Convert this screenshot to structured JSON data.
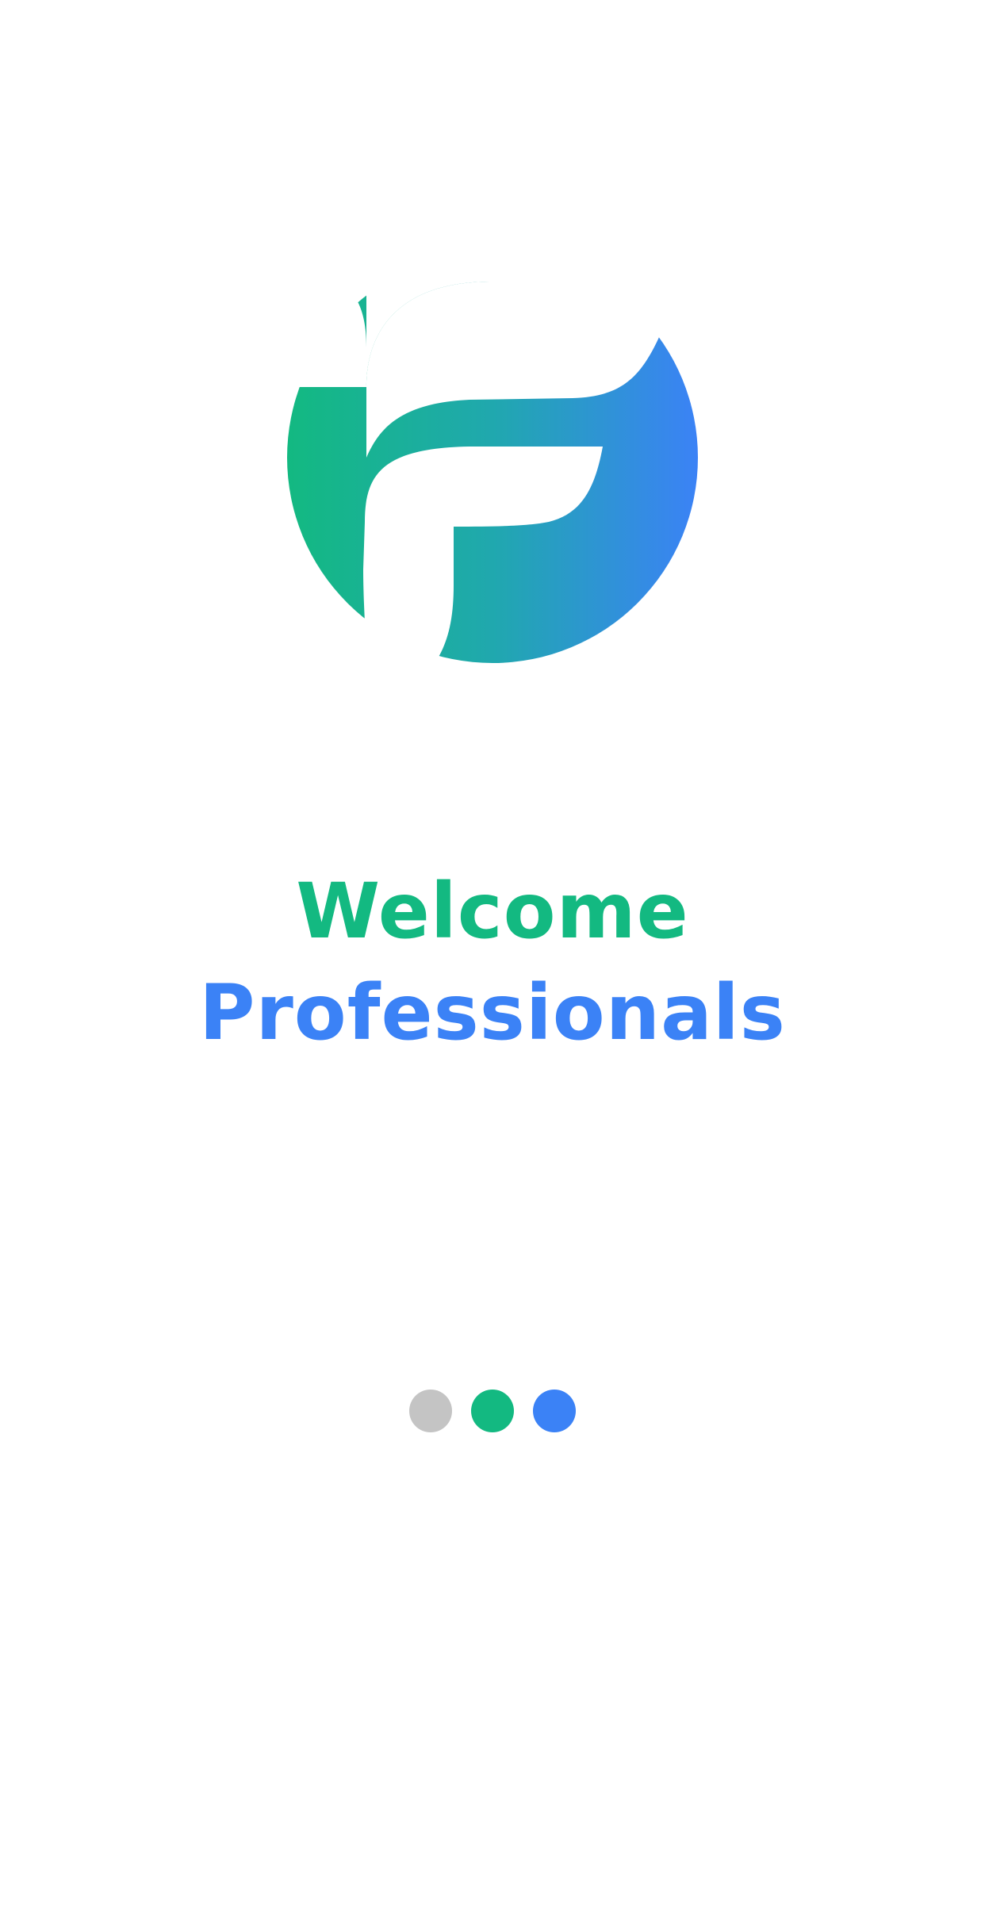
{
  "app": {
    "logo_icon": "f-logo-icon"
  },
  "colors": {
    "brand_green": "#13B981",
    "brand_teal": "#20A8AE",
    "brand_blue": "#3B82F6",
    "dot_inactive": "#C4C4C4",
    "background": "#FFFFFF"
  },
  "welcome": {
    "line1": "Welcome",
    "line2": "Professionals"
  },
  "pager": {
    "dots": [
      {
        "state": "inactive",
        "color": "#C4C4C4"
      },
      {
        "state": "active-green",
        "color": "#13B981"
      },
      {
        "state": "active-blue",
        "color": "#3B82F6"
      }
    ]
  }
}
